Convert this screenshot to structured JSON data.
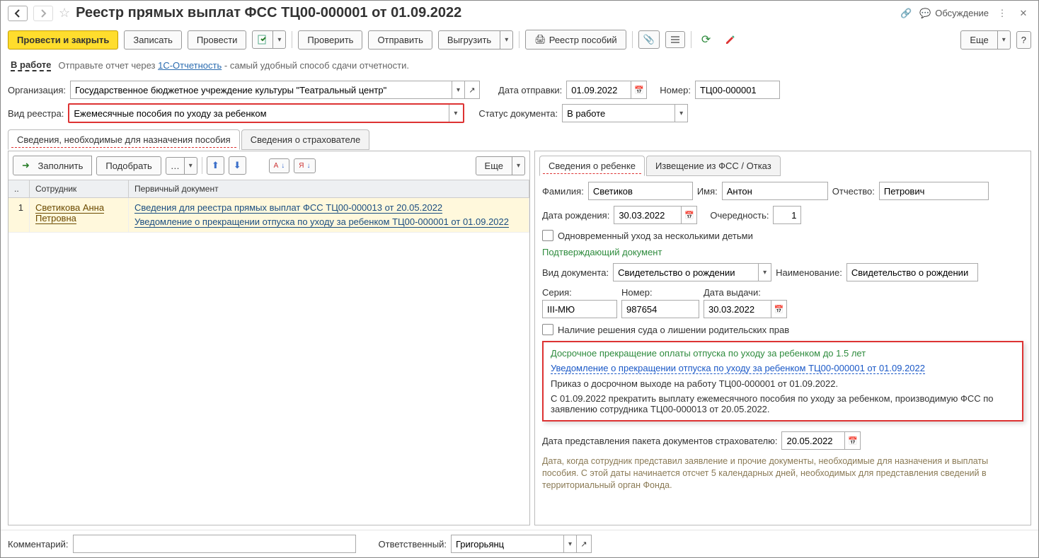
{
  "header": {
    "title": "Реестр прямых выплат ФСС ТЦ00-000001 от 01.09.2022",
    "discussion": "Обсуждение"
  },
  "toolbar": {
    "post_close": "Провести и закрыть",
    "save": "Записать",
    "post": "Провести",
    "check": "Проверить",
    "send": "Отправить",
    "export": "Выгрузить",
    "registry_benefits": "Реестр пособий",
    "more": "Еще"
  },
  "status": {
    "link": "В работе",
    "note_prefix": "Отправьте отчет через ",
    "note_link": "1С-Отчетность",
    "note_suffix": " - самый удобный способ сдачи отчетности."
  },
  "fields": {
    "org_label": "Организация:",
    "org_value": "Государственное бюджетное учреждение культуры \"Театральный центр\"",
    "send_date_label": "Дата отправки:",
    "send_date_value": "01.09.2022",
    "number_label": "Номер:",
    "number_value": "ТЦ00-000001",
    "registry_type_label": "Вид реестра:",
    "registry_type_value": "Ежемесячные пособия по уходу за ребенком",
    "doc_status_label": "Статус документа:",
    "doc_status_value": "В работе"
  },
  "tabs_main": [
    "Сведения, необходимые для назначения пособия",
    "Сведения о страхователе"
  ],
  "left": {
    "fill": "Заполнить",
    "pick": "Подобрать",
    "more": "Еще",
    "th_num": "..",
    "th_emp": "Сотрудник",
    "th_doc": "Первичный документ",
    "rows": [
      {
        "n": "1",
        "emp": "Светикова Анна Петровна",
        "docs": [
          "Сведения для реестра прямых выплат ФСС ТЦ00-000013 от 20.05.2022",
          "Уведомление о прекращении отпуска по уходу за ребенком ТЦ00-000001 от 01.09.2022"
        ]
      }
    ]
  },
  "right": {
    "tabs": [
      "Сведения о ребенке",
      "Извещение из ФСС / Отказ"
    ],
    "child": {
      "fam_label": "Фамилия:",
      "fam": "Светиков",
      "name_label": "Имя:",
      "name": "Антон",
      "patr_label": "Отчество:",
      "patr": "Петрович",
      "dob_label": "Дата рождения:",
      "dob": "30.03.2022",
      "order_label": "Очередность:",
      "order": "1",
      "simul_label": "Одновременный уход за несколькими детьми",
      "docsec_title": "Подтверждающий документ",
      "doc_type_label": "Вид документа:",
      "doc_type": "Свидетельство о рождении",
      "doc_name_label": "Наименование:",
      "doc_name": "Свидетельство о рождении",
      "ser_label": "Серия:",
      "ser": "III-МЮ",
      "num_label": "Номер:",
      "num": "987654",
      "issue_label": "Дата выдачи:",
      "issue": "30.03.2022",
      "deprive_label": "Наличие решения суда о лишении родительских прав"
    },
    "redbox": {
      "title": "Досрочное прекращение оплаты отпуска по уходу за ребенком до 1.5 лет",
      "link": "Уведомление о прекращении отпуска по уходу за ребенком ТЦ00-000001 от 01.09.2022",
      "line1": "Приказ о досрочном выходе на работу ТЦ00-000001 от 01.09.2022.",
      "line2": "С 01.09.2022 прекратить выплату ежемесячного пособия по уходу за ребенком, производимую ФСС по заявлению сотрудника ТЦ00-000013 от 20.05.2022."
    },
    "pkg_date_label": "Дата представления пакета документов страхователю:",
    "pkg_date": "20.05.2022",
    "note": "Дата, когда сотрудник представил заявление и прочие документы, необходимые для назначения и выплаты пособия. С этой даты начинается отсчет 5 календарных дней, необходимых для представления сведений в территориальный орган Фонда."
  },
  "bottom": {
    "comment_label": "Комментарий:",
    "responsible_label": "Ответственный:",
    "responsible_value": "Григорьянц"
  }
}
